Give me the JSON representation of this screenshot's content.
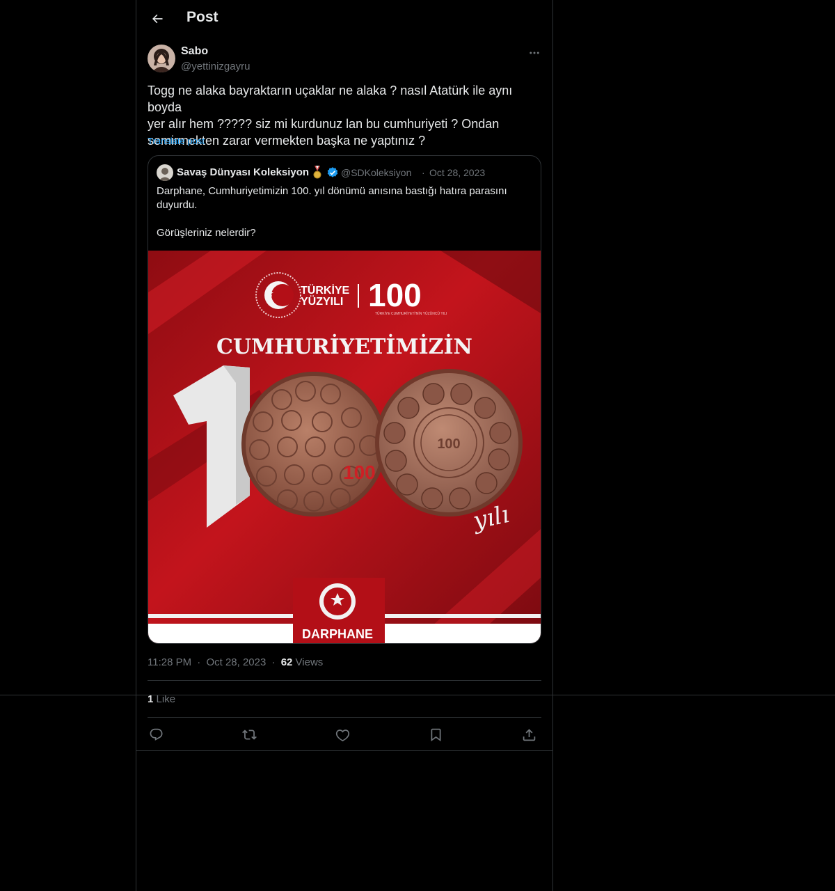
{
  "header": {
    "title": "Post"
  },
  "post": {
    "author_name": "Sabo",
    "author_handle": "@yettinizgayru",
    "text": "Togg ne alaka bayraktarın uçaklar ne alaka ? nasıl Atatürk ile aynı boyda\nyer alır hem ????? siz mi kurdunuz lan bu cumhuriyeti ? Ondan\nsemirmekten zarar vermekten başka ne yaptınız ?",
    "translate_label": "Translate post",
    "time": "11:28 PM",
    "date": "Oct 28, 2023",
    "views_count": "62",
    "views_label": "Views",
    "likes_count": "1",
    "likes_label": "Like"
  },
  "quote": {
    "author_name": "Savaş Dünyası Koleksiyon",
    "author_handle": "@SDKoleksiyon",
    "separator": "·",
    "date": "Oct 28, 2023",
    "text": "Darphane, Cumhuriyetimizin 100. yıl dönümü anısına bastığı hatıra parasını\nduyurdu.\n\nGörüşleriniz nelerdir?",
    "image": {
      "brand_line1": "TÜRKİYE",
      "brand_line2": "YÜZYILI",
      "brand_number": "100",
      "brand_tagline": "TÜRKİYE CUMHURİYETİ'NİN YÜZÜNCÜ YILI",
      "headline": "CUMHURİYETİMİZİN",
      "big_digit": "1",
      "script_word": "yılı",
      "footer_logo": "DARPHANE",
      "colors": {
        "background": "#b30f17",
        "dark": "#6e0a10",
        "coin": "#a56a50"
      }
    }
  },
  "meta_separator": "·",
  "actions": [
    "reply-icon",
    "repost-icon",
    "like-icon",
    "bookmark-icon",
    "share-icon"
  ]
}
